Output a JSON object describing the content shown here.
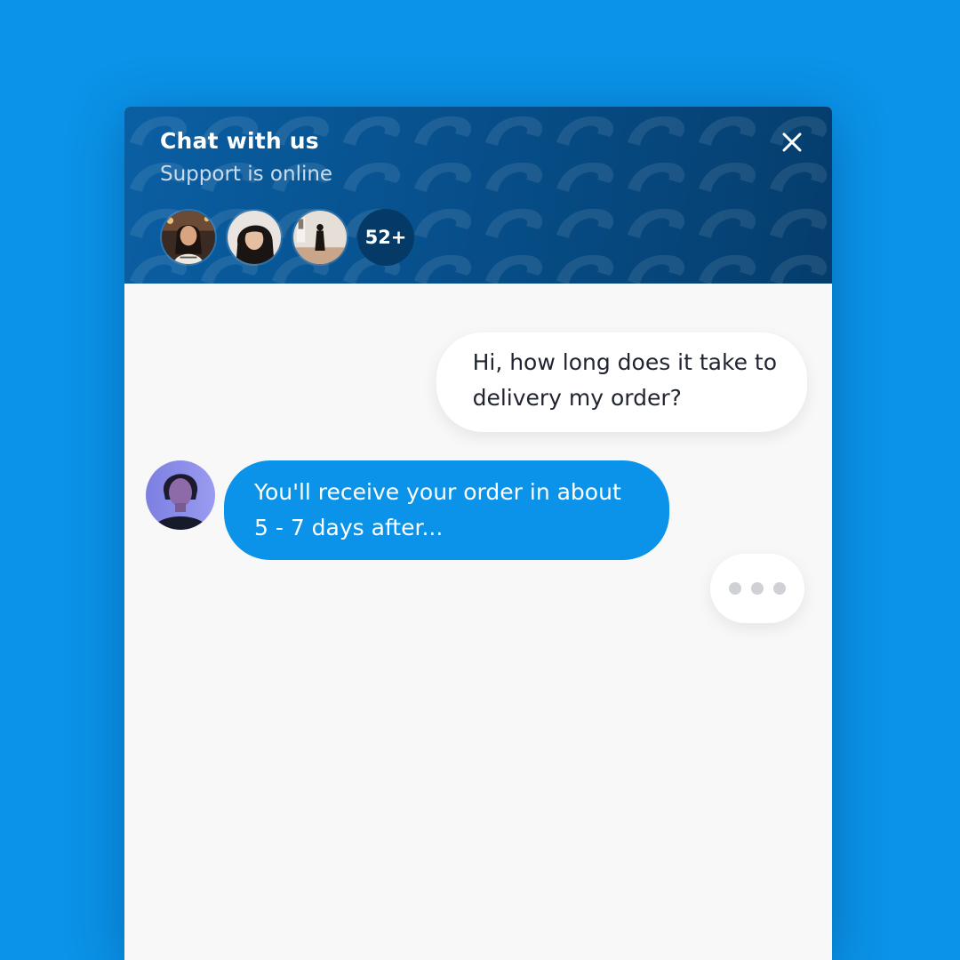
{
  "header": {
    "title": "Chat with us",
    "subtitle": "Support is online",
    "close_icon": "close-icon",
    "agents_more_count": "52+"
  },
  "messages": {
    "user": {
      "lines": [
        "Hi, how long does it take to",
        "delivery my order?"
      ]
    },
    "agent": {
      "lines": [
        "You'll receive your order in about",
        "5 - 7 days after..."
      ]
    },
    "typing_indicator": "typing-dots-icon"
  },
  "colors": {
    "background": "#0a93e8",
    "header_dark": "#053d6c",
    "agent_bubble": "#0a93e8",
    "user_bubble": "#ffffff"
  }
}
